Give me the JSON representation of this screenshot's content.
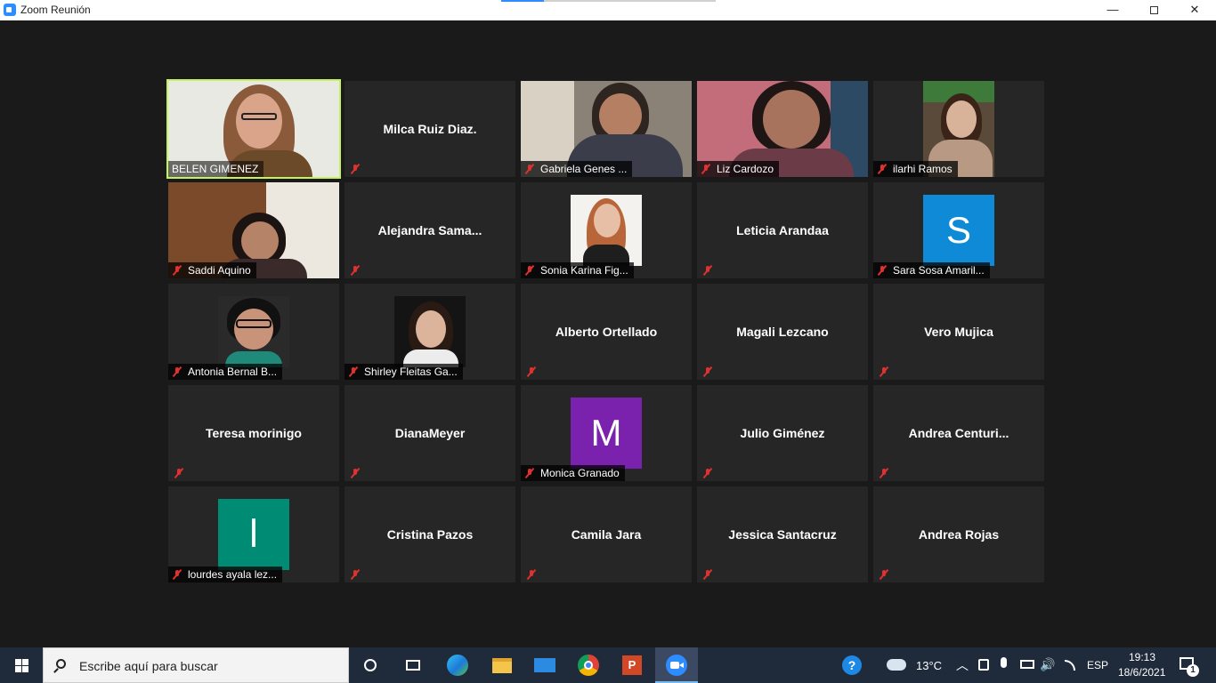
{
  "window": {
    "title": "Zoom Reunión",
    "minimize": "—",
    "close": "✕"
  },
  "participants": [
    {
      "name": "BELEN GIMENEZ",
      "video": true,
      "active": true,
      "muted": false
    },
    {
      "name": "Milca Ruiz Diaz.",
      "label": "",
      "video": false,
      "muted": true
    },
    {
      "name": "Gabriela Genes ...",
      "video": true,
      "muted": true
    },
    {
      "name": "Liz Cardozo",
      "video": true,
      "muted": true
    },
    {
      "name": "ilarhi Ramos",
      "video": true,
      "muted": true
    },
    {
      "name": "Saddi Aquino",
      "video": true,
      "muted": true
    },
    {
      "name": "Alejandra  Sama...",
      "video": false,
      "muted": true
    },
    {
      "name": "Sonia Karina Fig...",
      "video": true,
      "muted": true
    },
    {
      "name": "Leticia Arandaa",
      "video": false,
      "muted": true
    },
    {
      "name": "Sara Sosa Amaril...",
      "avatar_letter": "S",
      "avatar_color": "#0e8ad6",
      "muted": true
    },
    {
      "name": "Antonia Bernal B...",
      "video": true,
      "muted": true
    },
    {
      "name": "Shirley Fleitas Ga...",
      "video": true,
      "muted": true
    },
    {
      "name": "Alberto Ortellado",
      "video": false,
      "muted": true
    },
    {
      "name": "Magali Lezcano",
      "video": false,
      "muted": true
    },
    {
      "name": "Vero Mujica",
      "video": false,
      "muted": true
    },
    {
      "name": "Teresa morinigo",
      "video": false,
      "muted": true
    },
    {
      "name": "DianaMeyer",
      "video": false,
      "muted": true
    },
    {
      "name": "Monica Granado",
      "avatar_letter": "M",
      "avatar_color": "#7a22ae",
      "muted": true
    },
    {
      "name": "Julio Giménez",
      "video": false,
      "muted": true
    },
    {
      "name": "Andrea  Centuri...",
      "video": false,
      "muted": true
    },
    {
      "name": "lourdes ayala lez...",
      "avatar_letter": "l",
      "avatar_color": "#008b74",
      "muted": true
    },
    {
      "name": "Cristina Pazos",
      "video": false,
      "muted": true
    },
    {
      "name": "Camila Jara",
      "video": false,
      "muted": true
    },
    {
      "name": "Jessica Santacruz",
      "video": false,
      "muted": true
    },
    {
      "name": "Andrea Rojas",
      "video": false,
      "muted": true
    }
  ],
  "taskbar": {
    "search_placeholder": "Escribe aquí para buscar",
    "weather_temp": "13°C",
    "language": "ESP",
    "time": "19:13",
    "date": "18/6/2021",
    "notification_count": "1"
  }
}
